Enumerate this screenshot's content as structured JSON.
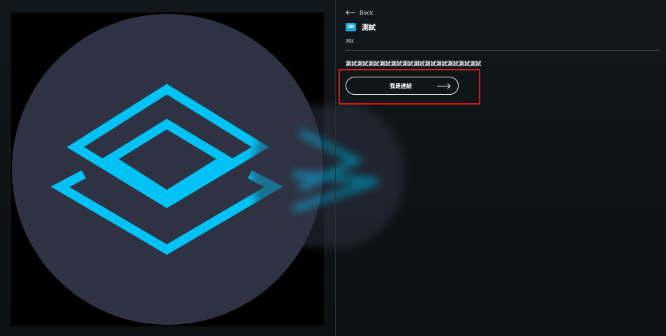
{
  "header": {
    "back_label": "Back"
  },
  "item": {
    "badge": "2D",
    "title": "測試",
    "subtitle": "測試",
    "description": "測試測試測試測試測試測試測試測試測試測試測試測試",
    "link_label": "我是連結"
  },
  "colors": {
    "accent": "#1aa8dc",
    "logo_circle": "#2f3242",
    "logo_stroke": "#00c2f5",
    "highlight": "#d11a1a",
    "background": "#0e1215"
  },
  "icons": {
    "back": "arrow-left-icon",
    "link": "arrow-right-icon",
    "logo": "stacked-layers-logo"
  }
}
